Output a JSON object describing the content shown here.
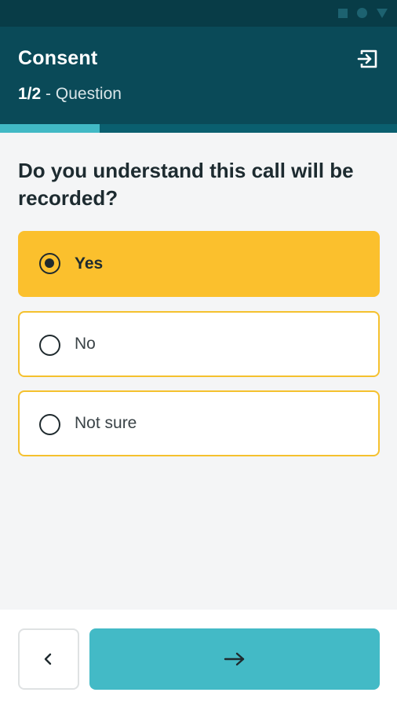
{
  "header": {
    "title": "Consent",
    "progress_label": "1/2",
    "progress_separator": " - ",
    "section_label": "Question",
    "exit_icon": "exit-icon",
    "progress_fraction": 0.25
  },
  "question": {
    "text": "Do you understand this call will be recorded?",
    "options": [
      {
        "label": "Yes",
        "selected": true
      },
      {
        "label": "No",
        "selected": false
      },
      {
        "label": "Not sure",
        "selected": false
      }
    ]
  },
  "footer": {
    "back_icon": "chevron-left-icon",
    "next_icon": "arrow-right-icon"
  },
  "colors": {
    "header_bg": "#0a4a58",
    "status_bg": "#083c47",
    "progress_fill": "#41b9c5",
    "selected_option": "#fbc02d",
    "option_border": "#f5c12e",
    "next_button": "#43bac6"
  }
}
